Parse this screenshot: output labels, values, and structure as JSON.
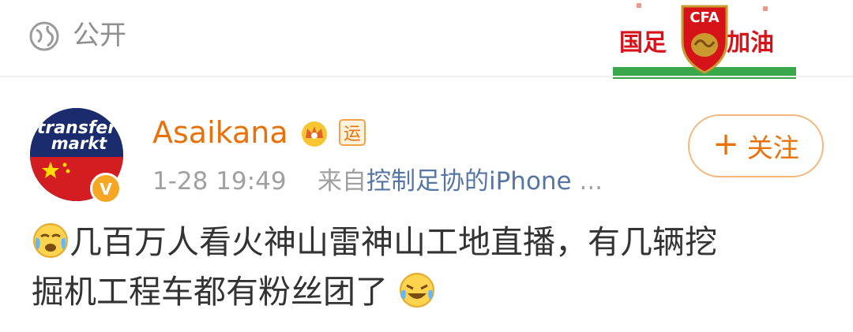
{
  "header": {
    "visibility_icon": "globe-icon",
    "visibility_label": "公开",
    "badge": {
      "name": "cfa-badge-icon",
      "text_left": "国足",
      "text_right": "加油",
      "emblem_text": "CFA"
    }
  },
  "post": {
    "avatar": {
      "name": "avatar",
      "brand_line1": "transfer",
      "brand_line2": "markt",
      "verified_icon": "verified-v-icon",
      "verified_text": "V"
    },
    "username": "Asaikana",
    "username_badges": [
      "crown-icon",
      "vip-icon"
    ],
    "vip_text": "运",
    "time": "1-28 19:49",
    "source_prefix": "来自",
    "source": "控制足协的iPhone",
    "source_suffix": " ...",
    "follow_label": "关注",
    "follow_icon": "plus-icon",
    "follow_plus": "+",
    "text_line1": "几百万人看火神山雷神山工地直播，有几辆挖",
    "text_line2": "掘机工程车都有粉丝团了",
    "emoji_start": "crying-face-emoji",
    "emoji_end": "laughing-tears-emoji"
  },
  "colors": {
    "username": "#e8710a",
    "link": "#5576a5",
    "meta": "#a0a0a0",
    "text": "#333333"
  }
}
